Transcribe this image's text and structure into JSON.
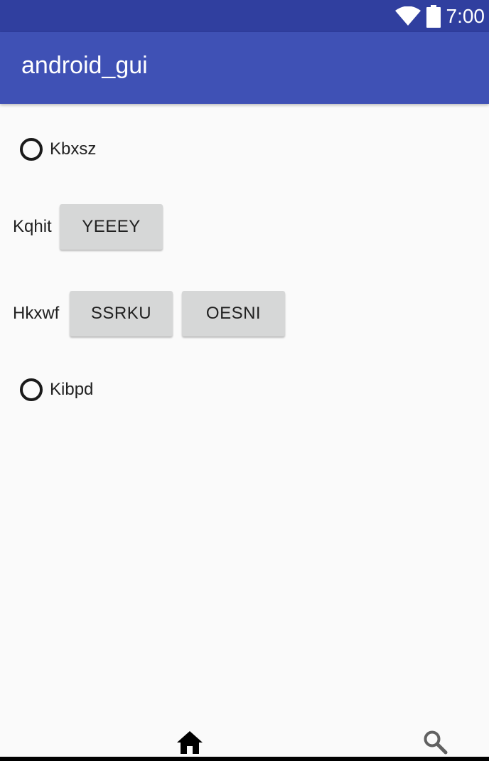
{
  "status_bar": {
    "time": "7:00",
    "icons": [
      "wifi-icon",
      "battery-icon"
    ]
  },
  "app_bar": {
    "title": "android_gui"
  },
  "content": {
    "radio_1": {
      "label": "Kbxsz",
      "checked": false
    },
    "row_1": {
      "label": "Kqhit",
      "button": "YEEEY"
    },
    "row_2": {
      "label": "Hkxwf",
      "button_1": "SSRKU",
      "button_2": "OESNI"
    },
    "radio_2": {
      "label": "Kibpd",
      "checked": false
    }
  },
  "bottom_nav": {
    "icons": [
      "home-icon",
      "search-icon"
    ]
  },
  "colors": {
    "status_bar": "#303f9f",
    "app_bar": "#3f51b5",
    "background": "#fafafa",
    "button": "#d6d7d7"
  }
}
